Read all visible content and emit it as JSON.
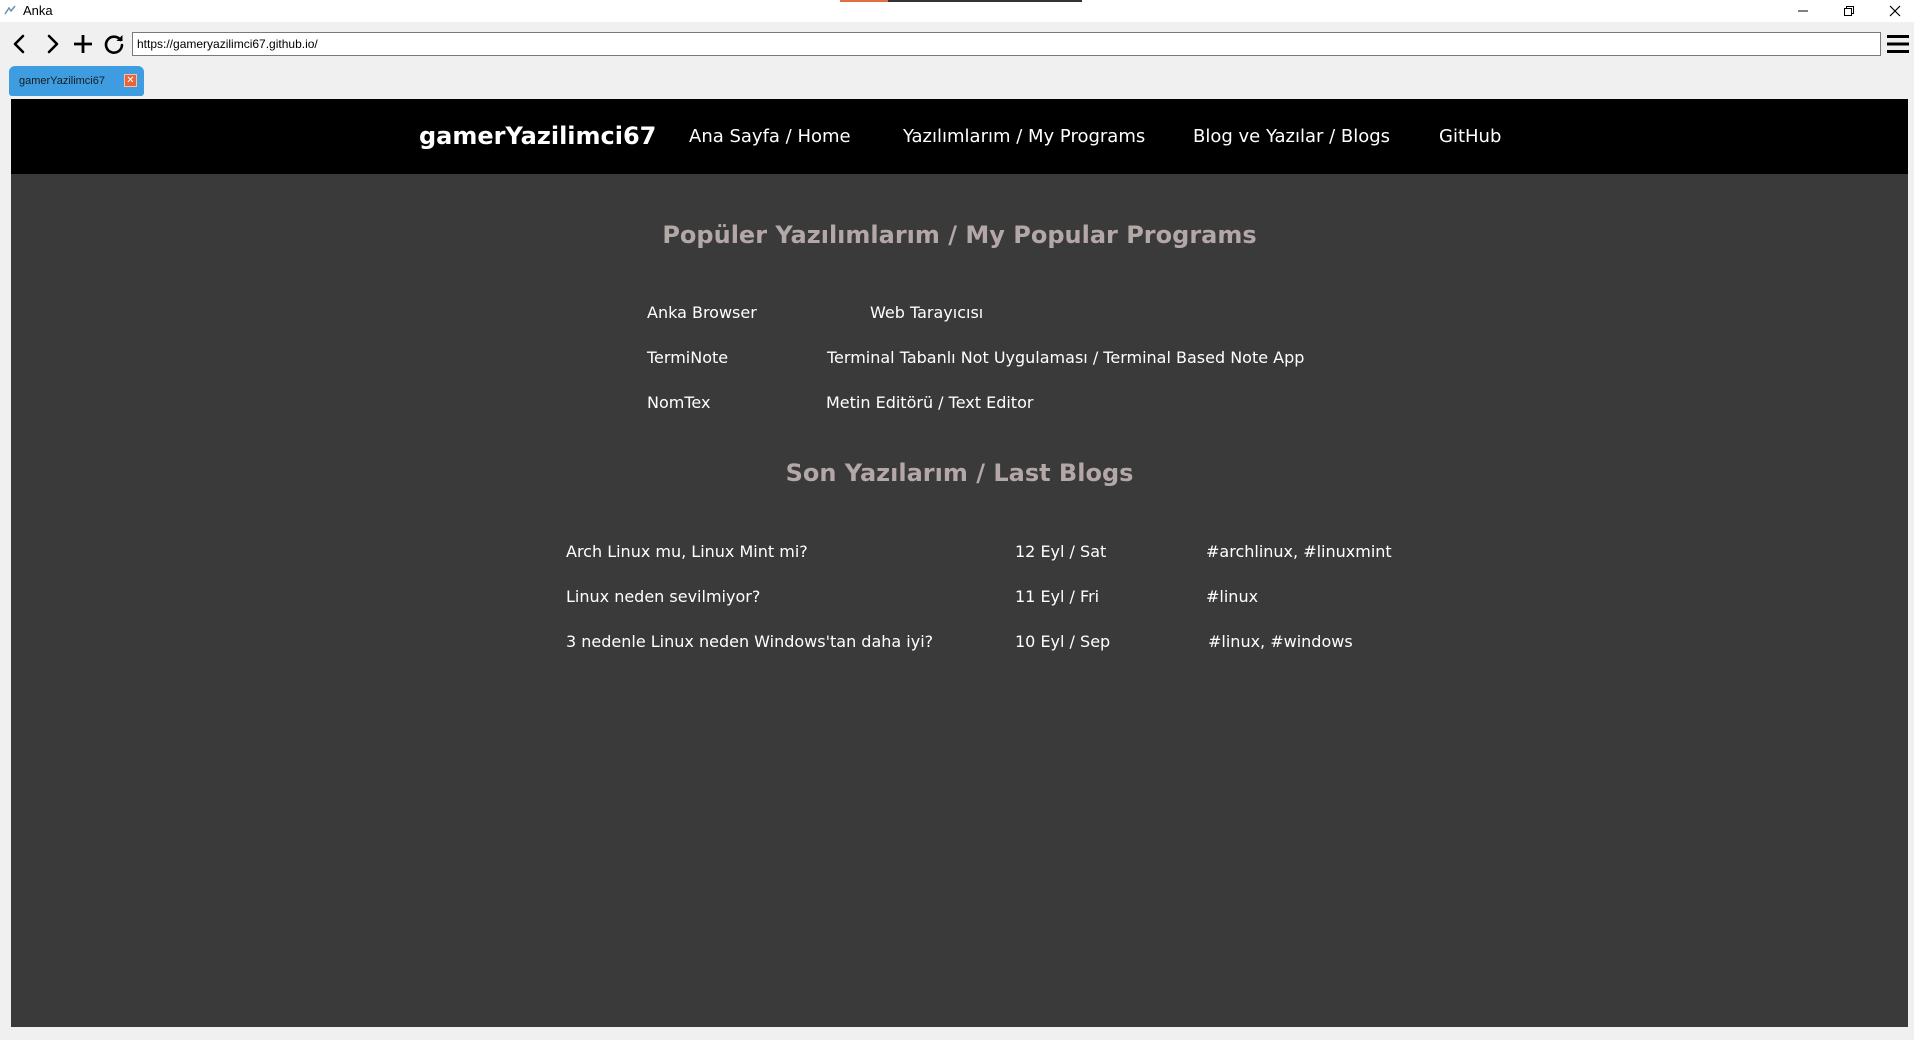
{
  "window": {
    "title": "Anka"
  },
  "toolbar": {
    "url": "https://gameryazilimci67.github.io/"
  },
  "tabs": [
    {
      "label": "gamerYazilimci67",
      "active": true
    }
  ],
  "site": {
    "brand": "gamerYazilimci67",
    "nav": {
      "home": "Ana Sayfa / Home",
      "programs": "Yazılımlarım / My Programs",
      "blogs": "Blog ve Yazılar / Blogs",
      "github": "GitHub"
    },
    "programs_title": "Popüler Yazılımlarım / My Popular Programs",
    "programs": [
      {
        "name": "Anka Browser",
        "description": "Web Tarayıcısı"
      },
      {
        "name": "TermiNote",
        "description": "Terminal Tabanlı Not Uygulaması / Terminal Based Note App"
      },
      {
        "name": "NomTex",
        "description": "Metin Editörü / Text Editor"
      }
    ],
    "blogs_title": "Son Yazılarım / Last Blogs",
    "blogs": [
      {
        "title": "Arch Linux mu, Linux Mint mi?",
        "date": "12 Eyl / Sat",
        "tags": "#archlinux, #linuxmint"
      },
      {
        "title": "Linux neden sevilmiyor?",
        "date": "11 Eyl / Fri",
        "tags": "#linux"
      },
      {
        "title": "3 nedenle Linux neden Windows'tan daha iyi?",
        "date": "10 Eyl / Sep",
        "tags": "#linux, #windows"
      }
    ]
  },
  "colors": {
    "page_background": "#3a3a3a",
    "nav_background": "#000000",
    "section_title": "#b4a7a7",
    "active_tab": "#3d9de0",
    "tab_close": "#e8643c"
  },
  "icons": {
    "window": [
      "app-icon",
      "minimize-icon",
      "restore-icon",
      "close-icon"
    ],
    "toolbar": [
      "back-arrow-icon",
      "forward-arrow-icon",
      "plus-icon",
      "reload-icon",
      "hamburger-menu-icon"
    ]
  }
}
